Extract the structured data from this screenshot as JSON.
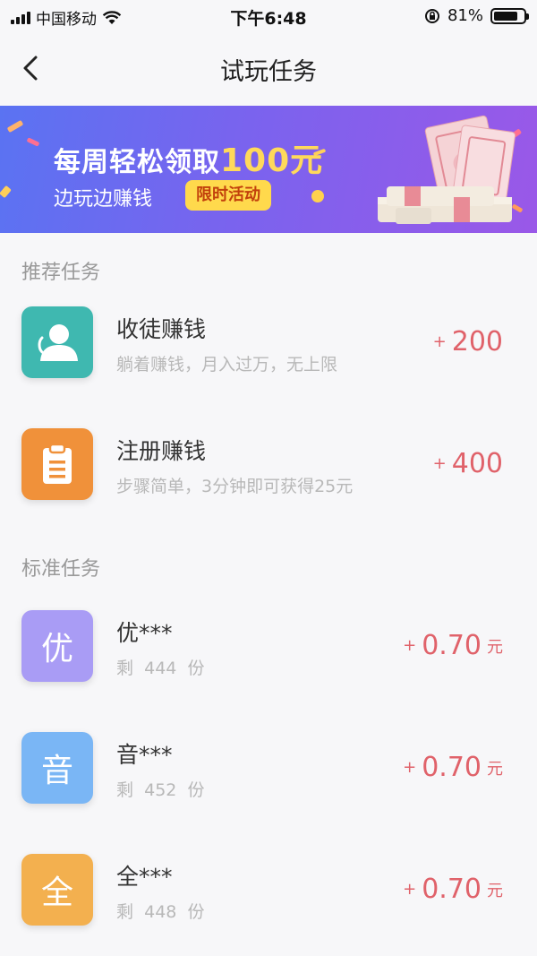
{
  "status_bar": {
    "carrier": "中国移动",
    "time": "下午6:48",
    "battery": "81%",
    "battery_level": 0.81
  },
  "nav": {
    "title": "试玩任务",
    "back_icon": "chevron-left-icon"
  },
  "banner": {
    "headline_prefix": "每周轻松领取",
    "headline_amount": "100元",
    "subtitle": "边玩边赚钱",
    "tag": "限时活动",
    "colors": {
      "start": "#5a73f2",
      "end": "#9a58e8",
      "highlight": "#ffd95a",
      "tag_bg": "#ffd94c"
    }
  },
  "recommended": {
    "title": "推荐任务",
    "items": [
      {
        "name": "收徒赚钱",
        "desc": "躺着赚钱，月入过万，无上限",
        "plus": "+",
        "amount": "200",
        "icon": "user-icon",
        "color": "#3fb8b0"
      },
      {
        "name": "注册赚钱",
        "desc": "步骤简单，3分钟即可获得25元",
        "plus": "+",
        "amount": "400",
        "icon": "clipboard-icon",
        "color": "#f0913a"
      }
    ]
  },
  "standard": {
    "title": "标准任务",
    "items": [
      {
        "glyph": "优",
        "name": "优***",
        "desc_prefix": "剩",
        "count": "444",
        "desc_suffix": "份",
        "plus": "+",
        "amount": "0.70",
        "unit": "元",
        "color": "#a99cf5"
      },
      {
        "glyph": "音",
        "name": "音***",
        "desc_prefix": "剩",
        "count": "452",
        "desc_suffix": "份",
        "plus": "+",
        "amount": "0.70",
        "unit": "元",
        "color": "#7ab6f5"
      },
      {
        "glyph": "全",
        "name": "全***",
        "desc_prefix": "剩",
        "count": "448",
        "desc_suffix": "份",
        "plus": "+",
        "amount": "0.70",
        "unit": "元",
        "color": "#f3b04f"
      }
    ]
  },
  "accent_color": "#e0626a"
}
